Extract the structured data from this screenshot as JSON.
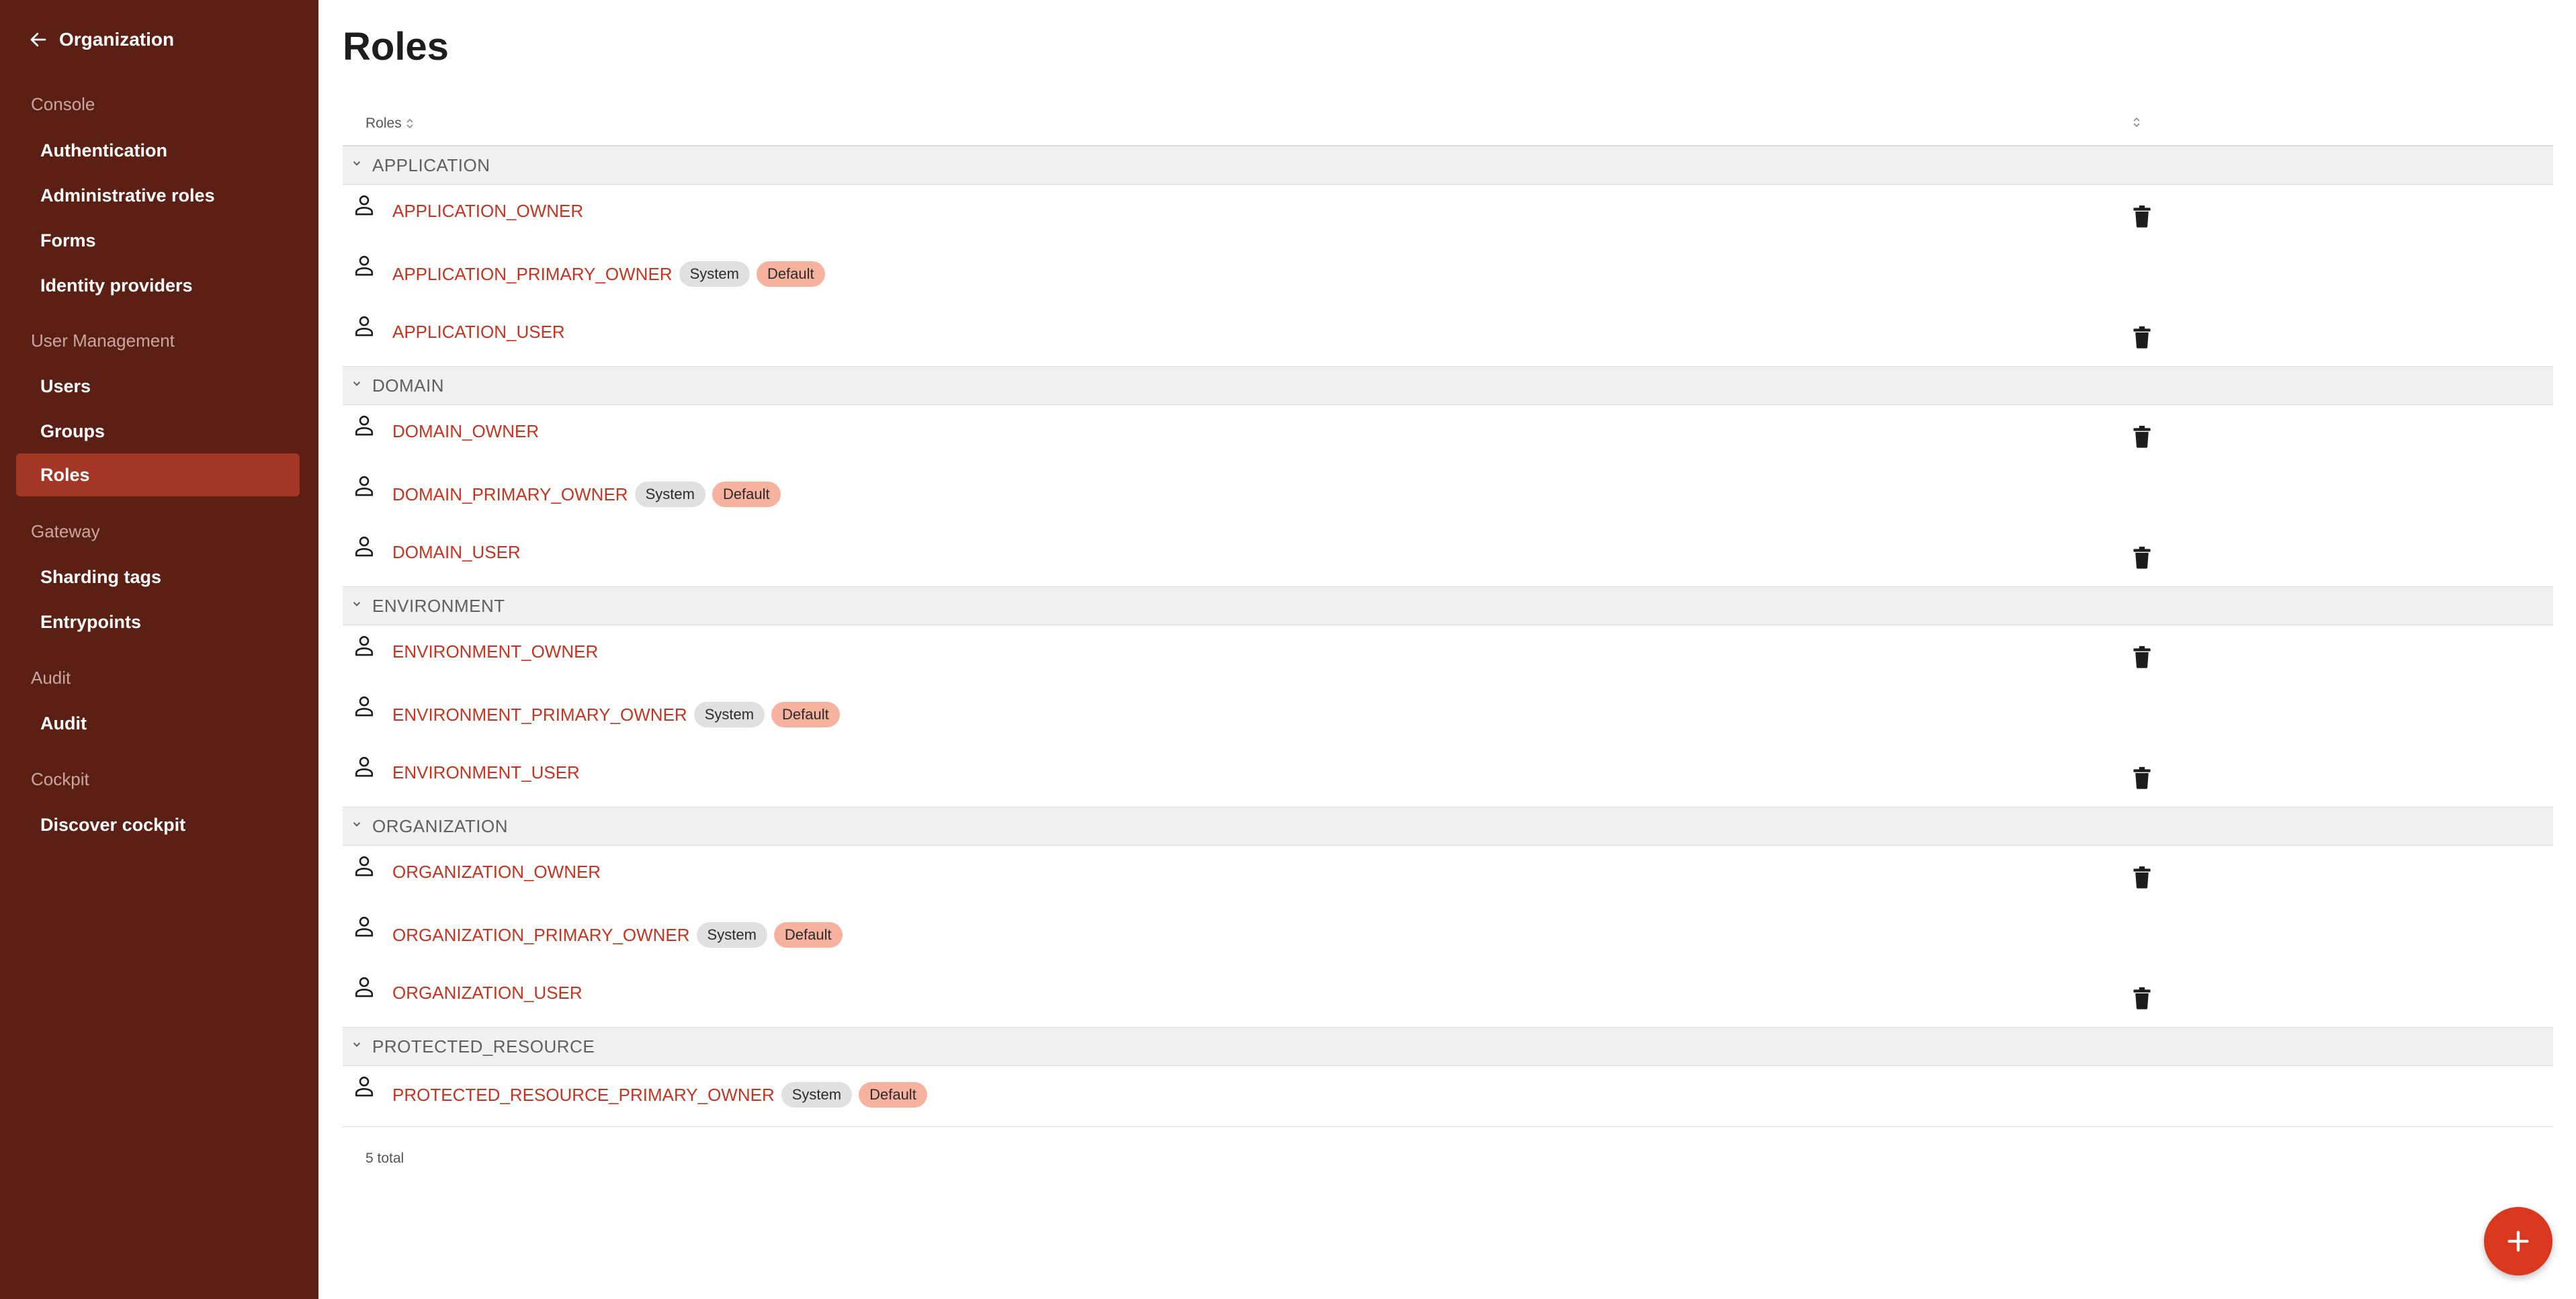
{
  "sidebar": {
    "back_label": "Organization",
    "sections": [
      {
        "title": "Console",
        "items": [
          "Authentication",
          "Administrative roles",
          "Forms",
          "Identity providers"
        ]
      },
      {
        "title": "User Management",
        "items": [
          "Users",
          "Groups",
          "Roles"
        ]
      },
      {
        "title": "Gateway",
        "items": [
          "Sharding tags",
          "Entrypoints"
        ]
      },
      {
        "title": "Audit",
        "items": [
          "Audit"
        ]
      },
      {
        "title": "Cockpit",
        "items": [
          "Discover cockpit"
        ]
      }
    ],
    "active_item": "Roles"
  },
  "page": {
    "title": "Roles"
  },
  "table": {
    "column_header": "Roles",
    "groups": [
      {
        "name": "APPLICATION",
        "rows": [
          {
            "name": "APPLICATION_OWNER",
            "system": false,
            "default": false,
            "deletable": true
          },
          {
            "name": "APPLICATION_PRIMARY_OWNER",
            "system": true,
            "default": true,
            "deletable": false
          },
          {
            "name": "APPLICATION_USER",
            "system": false,
            "default": false,
            "deletable": true
          }
        ]
      },
      {
        "name": "DOMAIN",
        "rows": [
          {
            "name": "DOMAIN_OWNER",
            "system": false,
            "default": false,
            "deletable": true
          },
          {
            "name": "DOMAIN_PRIMARY_OWNER",
            "system": true,
            "default": true,
            "deletable": false
          },
          {
            "name": "DOMAIN_USER",
            "system": false,
            "default": false,
            "deletable": true
          }
        ]
      },
      {
        "name": "ENVIRONMENT",
        "rows": [
          {
            "name": "ENVIRONMENT_OWNER",
            "system": false,
            "default": false,
            "deletable": true
          },
          {
            "name": "ENVIRONMENT_PRIMARY_OWNER",
            "system": true,
            "default": true,
            "deletable": false
          },
          {
            "name": "ENVIRONMENT_USER",
            "system": false,
            "default": false,
            "deletable": true
          }
        ]
      },
      {
        "name": "ORGANIZATION",
        "rows": [
          {
            "name": "ORGANIZATION_OWNER",
            "system": false,
            "default": false,
            "deletable": true
          },
          {
            "name": "ORGANIZATION_PRIMARY_OWNER",
            "system": true,
            "default": true,
            "deletable": false
          },
          {
            "name": "ORGANIZATION_USER",
            "system": false,
            "default": false,
            "deletable": true
          }
        ]
      },
      {
        "name": "PROTECTED_RESOURCE",
        "rows": [
          {
            "name": "PROTECTED_RESOURCE_PRIMARY_OWNER",
            "system": true,
            "default": true,
            "deletable": false
          }
        ]
      }
    ],
    "badges": {
      "system": "System",
      "default": "Default"
    },
    "footer_total": "5 total"
  },
  "colors": {
    "sidebar_bg": "#5c1f14",
    "active_item_bg": "#a33624",
    "link": "#c8331f",
    "fab": "#d9381e",
    "default_badge": "#f6b19f",
    "system_badge": "#e0e0e0"
  },
  "icons": {
    "back": "arrow-left-icon",
    "role": "person-icon",
    "delete": "trash-icon",
    "group_toggle": "chevron-down-icon",
    "sort": "sort-icon",
    "add": "plus-icon"
  }
}
